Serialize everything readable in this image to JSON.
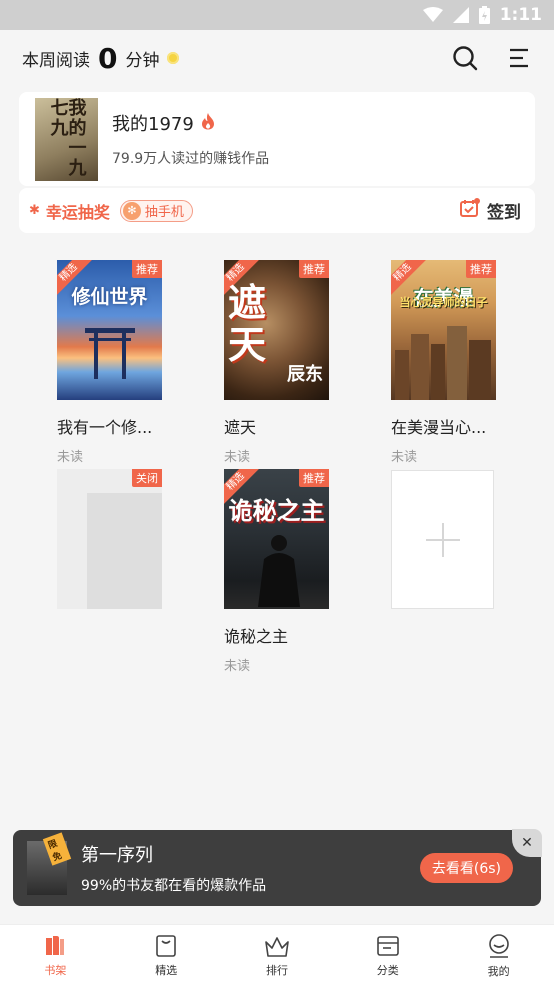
{
  "status_bar": {
    "time": "1:11"
  },
  "header": {
    "reading_prefix": "本周阅读",
    "reading_minutes": "0",
    "reading_suffix": "分钟"
  },
  "featured": {
    "cover_text": "我的一九七九",
    "title": "我的1979",
    "subtitle": "79.9万人读过的赚钱作品"
  },
  "lottery": {
    "label": "幸运抽奖",
    "pill_text": "抽手机",
    "sign_label": "签到"
  },
  "books": [
    {
      "title": "我有一个修...",
      "status": "未读",
      "tag_tr": "推荐",
      "tag_tl": "精选",
      "cover_text": "修仙世界"
    },
    {
      "title": "遮天",
      "status": "未读",
      "tag_tr": "推荐",
      "tag_tl": "精选",
      "cover_text": "遮天",
      "cover_author": "辰东"
    },
    {
      "title": "在美漫当心...",
      "status": "未读",
      "tag_tr": "推荐",
      "tag_tl": "精选",
      "cover_text": "在美漫",
      "cover_sub": "当心灵导师的日子"
    },
    {
      "title": "",
      "status": "",
      "tag_tr": "关闭"
    },
    {
      "title": "诡秘之主",
      "status": "未读",
      "tag_tr": "推荐",
      "tag_tl": "精选",
      "cover_text": "诡秘之主"
    }
  ],
  "popup": {
    "cover_tag": "限免",
    "title": "第一序列",
    "subtitle": "99%的书友都在看的爆款作品",
    "button": "去看看(6s)"
  },
  "bottom_nav": [
    {
      "label": "书架",
      "icon": "bookshelf-icon",
      "active": true
    },
    {
      "label": "精选",
      "icon": "featured-icon"
    },
    {
      "label": "排行",
      "icon": "crown-icon"
    },
    {
      "label": "分类",
      "icon": "category-icon"
    },
    {
      "label": "我的",
      "icon": "profile-icon"
    }
  ],
  "colors": {
    "accent": "#f0664a",
    "background": "#f5f5f5"
  }
}
